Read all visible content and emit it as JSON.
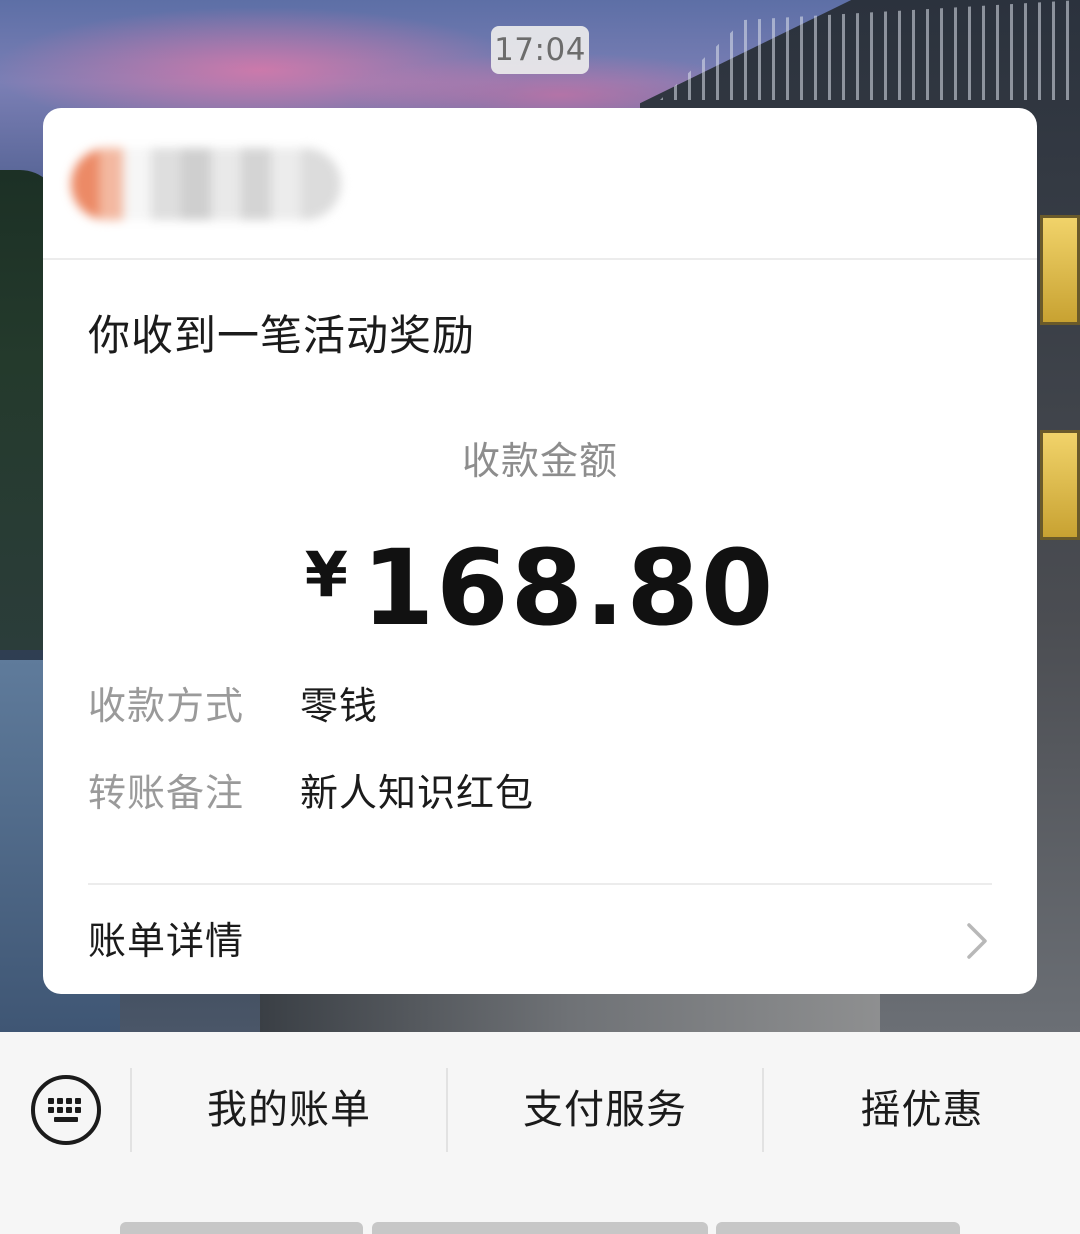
{
  "status": {
    "time": "17:04"
  },
  "card": {
    "sender_name_redacted": true,
    "title": "你收到一笔活动奖励",
    "amount_label": "收款金额",
    "amount_currency": "¥",
    "amount_value": "168.80",
    "rows": [
      {
        "label": "收款方式",
        "value": "零钱"
      },
      {
        "label": "转账备注",
        "value": "新人知识红包"
      }
    ],
    "bill_detail_label": "账单详情",
    "bill_detail_icon": "chevron-right-icon"
  },
  "menu": {
    "keyboard_icon": "keyboard-icon",
    "items": [
      {
        "label": "我的账单"
      },
      {
        "label": "支付服务"
      },
      {
        "label": "摇优惠"
      }
    ]
  },
  "colors": {
    "card_bg": "#ffffff",
    "primary_text": "#1b1b1b",
    "secondary_text": "#9a9a9a",
    "menu_bg": "#f6f6f6"
  }
}
